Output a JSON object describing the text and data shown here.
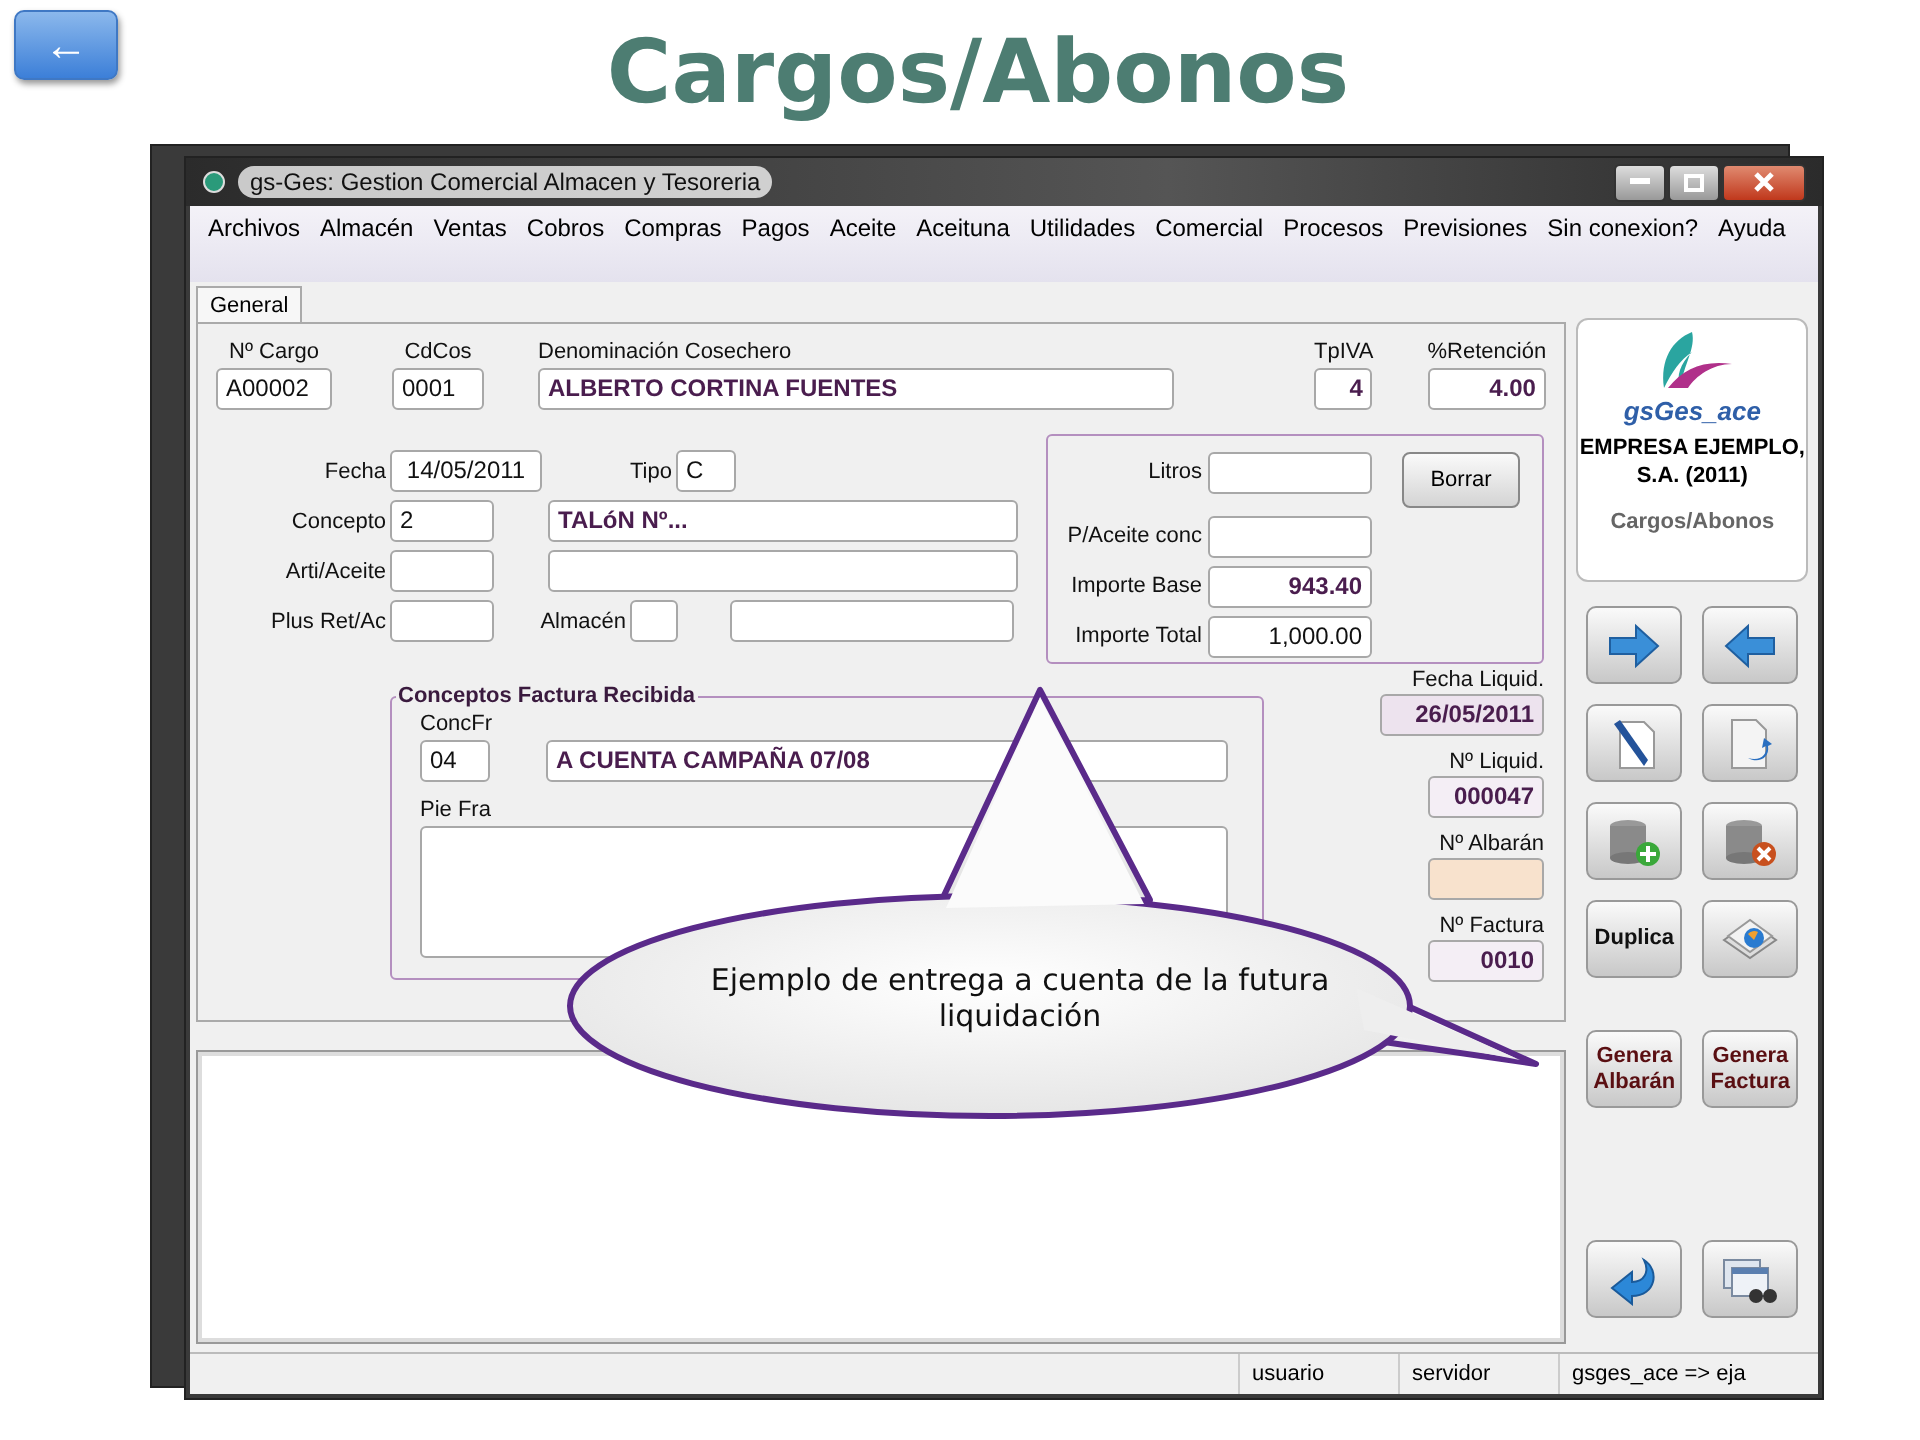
{
  "back_button": {
    "label": "←"
  },
  "slide_title": "Cargos/Abonos",
  "window": {
    "title": "gs-Ges: Gestion Comercial Almacen y Tesoreria"
  },
  "menu": [
    "Archivos",
    "Almacén",
    "Ventas",
    "Cobros",
    "Compras",
    "Pagos",
    "Aceite",
    "Aceituna",
    "Utilidades",
    "Comercial",
    "Procesos",
    "Previsiones",
    "Sin conexion?",
    "Ayuda"
  ],
  "tabs": [
    {
      "label": "General",
      "selected": true
    }
  ],
  "header_fields": [
    {
      "label": "Nº Cargo",
      "value": "A00002",
      "bold": false
    },
    {
      "label": "CdCos",
      "value": "0001",
      "bold": false
    },
    {
      "label": "Denominación Cosechero",
      "value": "ALBERTO CORTINA FUENTES",
      "bold": true
    },
    {
      "label": "TpIVA",
      "value": "4",
      "bold": true
    },
    {
      "label": "%Retención",
      "value": "4.00",
      "bold": true
    }
  ],
  "detail": {
    "fecha": {
      "label": "Fecha",
      "value": "14/05/2011"
    },
    "tipo": {
      "label": "Tipo",
      "value": "C"
    },
    "concepto": {
      "label": "Concepto",
      "code": "2",
      "description": "TALóN Nº..."
    },
    "arti_aceite": {
      "label": "Arti/Aceite"
    },
    "plus_ret": {
      "label": "Plus Ret/Ac"
    },
    "almacen": {
      "label": "Almacén"
    }
  },
  "amounts": [
    {
      "label": "Litros"
    },
    {
      "label": "P/Aceite conc"
    },
    {
      "label": "Importe Base",
      "value": "943.40",
      "bold": true
    },
    {
      "label": "Importe Total",
      "value": "1,000.00",
      "bold": false
    }
  ],
  "borrar_button": "Borrar",
  "conceptos_group": {
    "title": "Conceptos Factura Recibida",
    "concfr_label": "ConcFr",
    "concfr_code": "04",
    "concfr_description": "A CUENTA CAMPAÑA 07/08",
    "pie_label": "Pie Fra"
  },
  "liquidation": [
    {
      "label": "Fecha Liquid.",
      "value": "26/05/2011",
      "kind": "date"
    },
    {
      "label": "Nº Liquid.",
      "value": "000047",
      "kind": "number"
    },
    {
      "label": "Nº Albarán",
      "kind": "pending"
    },
    {
      "label": "Nº Factura",
      "value": "0010",
      "kind": "number"
    }
  ],
  "brand": {
    "logo_text": "gsGes_ace",
    "company": "EMPRESA EJEMPLO, S.A. (2011)",
    "module": "Cargos/Abonos"
  },
  "tool_buttons": [
    {
      "kind": "icon"
    },
    {
      "kind": "icon"
    },
    {
      "kind": "icon"
    },
    {
      "kind": "icon"
    },
    {
      "kind": "icon"
    },
    {
      "kind": "icon"
    },
    {
      "kind": "text",
      "label": "Duplica"
    },
    {
      "kind": "icon"
    },
    {
      "kind": "text",
      "label": "Genera Albarán"
    },
    {
      "kind": "text",
      "label": "Genera Factura"
    },
    {
      "kind": "icon"
    },
    {
      "kind": "icon"
    }
  ],
  "status_bar": [
    "usuario",
    "servidor",
    "gsges_ace => eja"
  ],
  "callout": {
    "text": "Ejemplo de entrega a cuenta de la futura liquidación"
  }
}
